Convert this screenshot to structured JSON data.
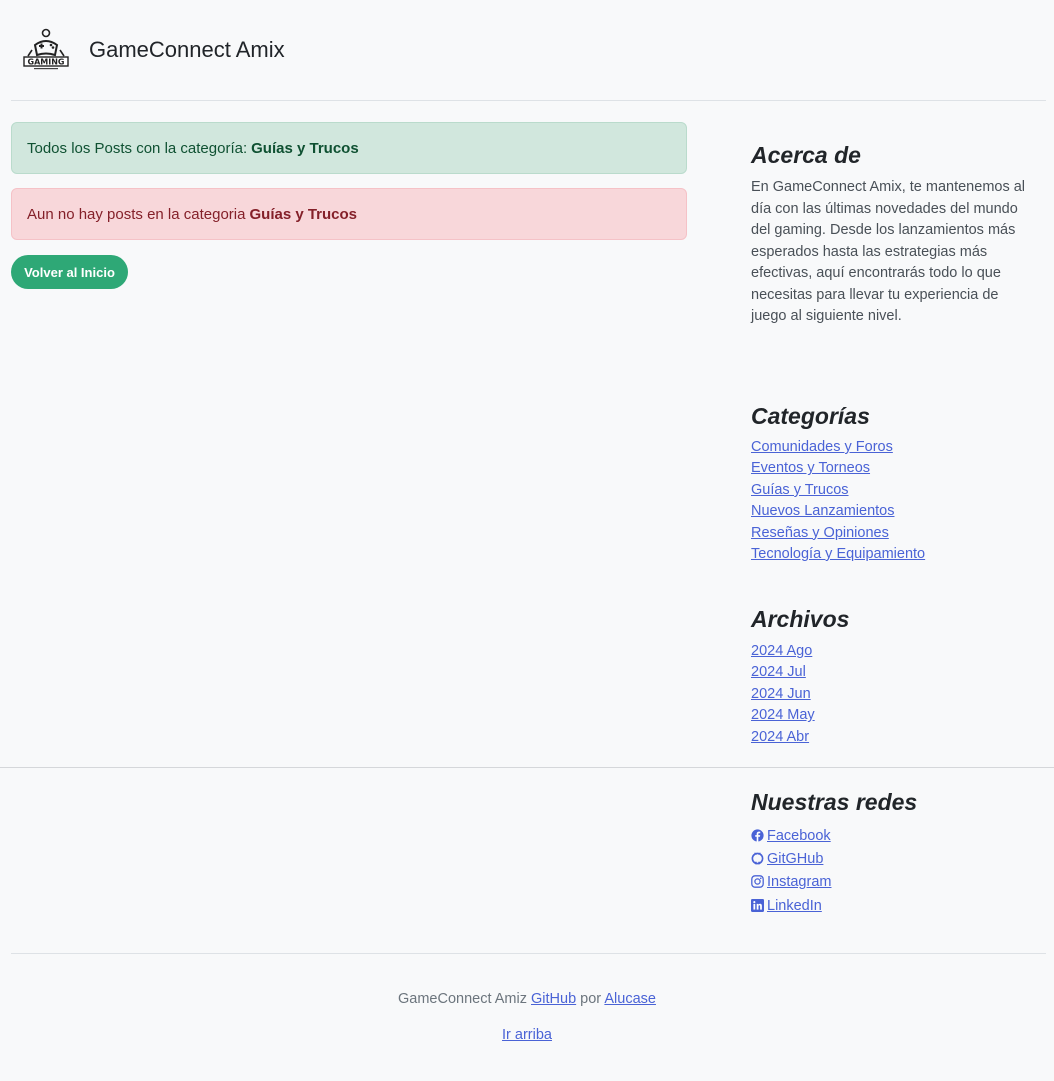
{
  "header": {
    "brand": "GameConnect Amix",
    "logo_text": "GAMING"
  },
  "main": {
    "alert_success_prefix": "Todos los Posts con la categoría:",
    "alert_success_category": "Guías y Trucos",
    "alert_danger_prefix": "Aun no hay posts en la categoria",
    "alert_danger_category": "Guías y Trucos",
    "home_button": "Volver al Inicio"
  },
  "sidebar": {
    "about_title": "Acerca de",
    "about_text": "En GameConnect Amix, te mantenemos al día con las últimas novedades del mundo del gaming. Desde los lanzamientos más esperados hasta las estrategias más efectivas, aquí encontrarás todo lo que necesitas para llevar tu experiencia de juego al siguiente nivel.",
    "categories_title": "Categorías",
    "categories": [
      "Comunidades y Foros",
      "Eventos y Torneos",
      "Guías y Trucos",
      "Nuevos Lanzamientos",
      "Reseñas y Opiniones",
      "Tecnología y Equipamiento"
    ],
    "archives_title": "Archivos",
    "archives": [
      "2024 Ago",
      "2024 Jul",
      "2024 Jun",
      "2024 May",
      "2024 Abr"
    ],
    "social_title": "Nuestras redes",
    "social": [
      {
        "label": "Facebook",
        "icon": "facebook-icon"
      },
      {
        "label": "GitGHub",
        "icon": "github-icon"
      },
      {
        "label": "Instagram",
        "icon": "instagram-icon"
      },
      {
        "label": "LinkedIn",
        "icon": "linkedin-icon"
      }
    ]
  },
  "footer": {
    "text_prefix": "GameConnect Amiz",
    "github_link": "GitHub",
    "text_middle": "por",
    "author_link": "Alucase",
    "back_to_top": "Ir arriba"
  },
  "colors": {
    "success_bg": "#d1e7dd",
    "danger_bg": "#f8d7da",
    "button_green": "#2ea876",
    "link": "#4a63d6"
  }
}
